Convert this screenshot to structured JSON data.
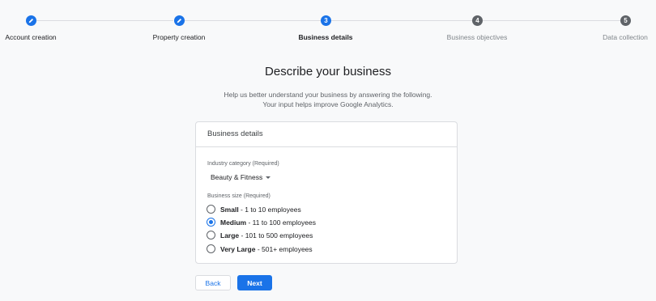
{
  "stepper": {
    "steps": [
      {
        "label": "Account creation",
        "marker": "edit-icon",
        "state": "done"
      },
      {
        "label": "Property creation",
        "marker": "edit-icon",
        "state": "done"
      },
      {
        "label": "Business details",
        "marker": "3",
        "state": "active"
      },
      {
        "label": "Business objectives",
        "marker": "4",
        "state": "todo"
      },
      {
        "label": "Data collection",
        "marker": "5",
        "state": "todo"
      }
    ]
  },
  "page": {
    "title": "Describe your business",
    "subtitle_line1": "Help us better understand your business by answering the following.",
    "subtitle_line2": "Your input helps improve Google Analytics."
  },
  "card": {
    "header": "Business details",
    "industry": {
      "label": "Industry category (Required)",
      "value": "Beauty & Fitness"
    },
    "size": {
      "label": "Business size (Required)",
      "options": [
        {
          "name": "Small",
          "detail": " - 1 to 10 employees",
          "selected": false
        },
        {
          "name": "Medium",
          "detail": " - 11 to 100 employees",
          "selected": true
        },
        {
          "name": "Large",
          "detail": " - 101 to 500 employees",
          "selected": false
        },
        {
          "name": "Very Large",
          "detail": " - 501+ employees",
          "selected": false
        }
      ]
    }
  },
  "actions": {
    "back_label": "Back",
    "next_label": "Next"
  },
  "colors": {
    "accent": "#1a73e8",
    "inactive_step": "#5f6368",
    "background": "#f8f9fa"
  }
}
